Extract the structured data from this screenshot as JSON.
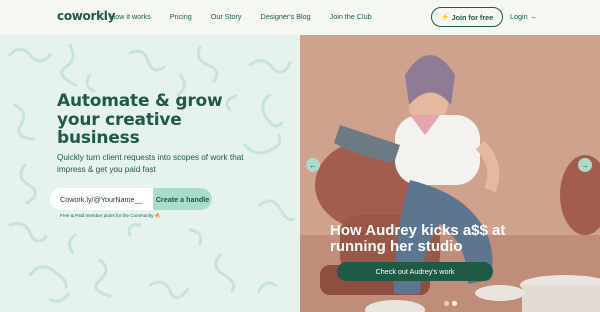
{
  "nav": {
    "logo": "coworkly",
    "links": [
      "How it works",
      "Pricing",
      "Our Story",
      "Designer's Blog",
      "Join the Club"
    ],
    "join_label": "Join for free",
    "login_label": "Login"
  },
  "hero": {
    "headline_line1": "Automate & grow",
    "headline_line2": "your creative",
    "headline_line3": "business",
    "subtext": "Quickly turn client requests into scopes of work that impress & get you paid fast",
    "url_value": "Cowork.ly/@YourName__",
    "create_label": "Create a handle",
    "free_note": "Free & Paid member plans for the Community 🔥"
  },
  "slide": {
    "title": "How Audrey kicks a$$ at running her studio",
    "cta_label": "Check out Audrey's work",
    "prev_icon": "←",
    "next_icon": "→",
    "dots": 2,
    "active_dot": 1
  },
  "colors": {
    "brand_green": "#1f5a45",
    "mint": "#a8dccb",
    "bg_mint": "#e6f2ee",
    "accent_orange": "#f0a23a"
  }
}
